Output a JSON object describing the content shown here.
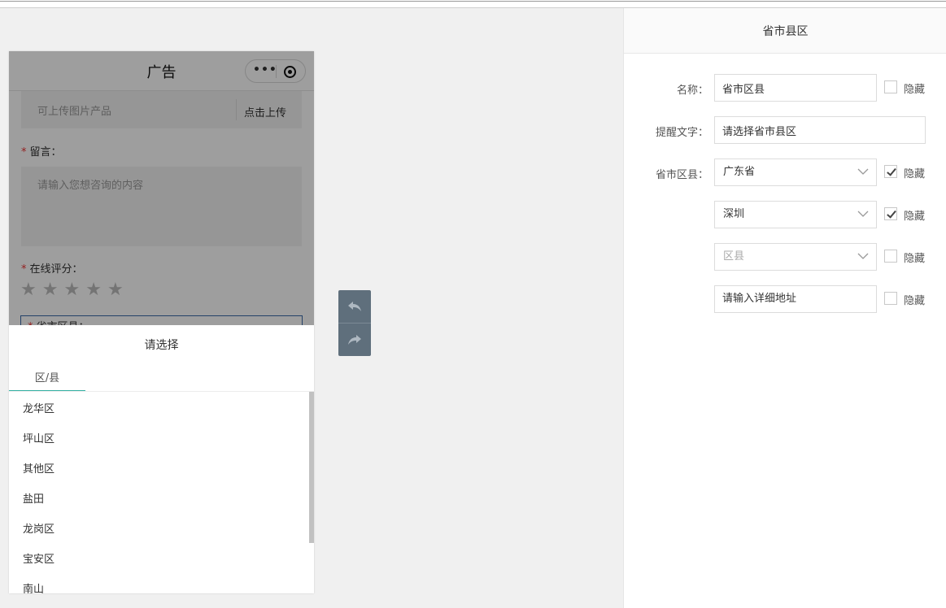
{
  "preview": {
    "nav_title": "广告",
    "capsule_more": "•••",
    "upload": {
      "hint": "可上传图片产品",
      "button": "点击上传"
    },
    "message": {
      "label": "留言：",
      "placeholder": "请输入您想咨询的内容"
    },
    "rating": {
      "label": "在线评分：",
      "stars": 5,
      "value": 0
    },
    "region": {
      "label": "省市区县："
    },
    "required_mark": "*"
  },
  "picker": {
    "title": "请选择",
    "active_tab": "区/县",
    "options": [
      "龙华区",
      "坪山区",
      "其他区",
      "盐田",
      "龙岗区",
      "宝安区",
      "南山"
    ]
  },
  "panel": {
    "title": "省市县区",
    "name_label": "名称：",
    "name_value": "省市区县",
    "hint_label": "提醒文字：",
    "hint_value": "请选择省市县区",
    "region_label": "省市区县：",
    "hide_label": "隐藏",
    "province": {
      "value": "广东省",
      "hidden": true
    },
    "city": {
      "value": "深圳",
      "hidden": true
    },
    "district": {
      "placeholder": "区县",
      "hidden": false
    },
    "address": {
      "placeholder": "请输入详细地址",
      "hidden": false
    },
    "name_hidden": false
  },
  "colors": {
    "accent": "#34b1a3",
    "required": "#e33333",
    "history_bg": "#5f6f7c"
  },
  "icons": {
    "undo": "undo-icon",
    "redo": "redo-icon",
    "chevron": "chevron-down-icon"
  }
}
